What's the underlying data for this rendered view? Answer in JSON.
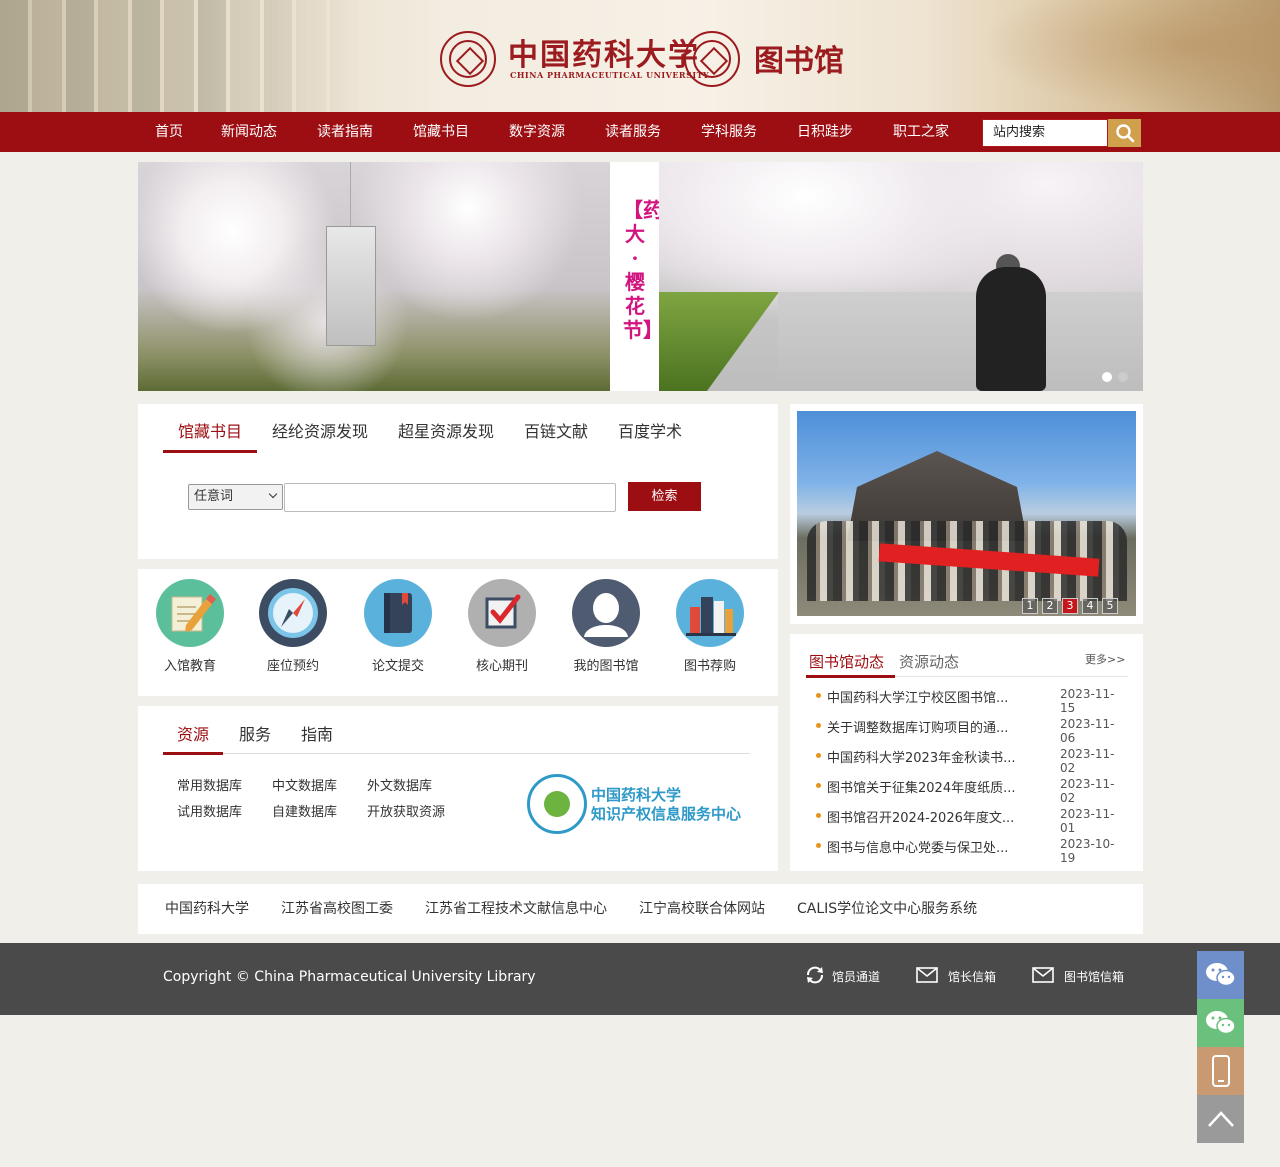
{
  "header": {
    "university_name": "中国药科大学",
    "university_en": "CHINA PHARMACEUTICAL UNIVERSITY",
    "library_name": "图书馆"
  },
  "nav": {
    "items": [
      "首页",
      "新闻动态",
      "读者指南",
      "馆藏书目",
      "数字资源",
      "读者服务",
      "学科服务",
      "日积跬步",
      "职工之家"
    ],
    "search_placeholder": "站内搜索"
  },
  "banner": {
    "vertical_title": "【药大·樱花节】",
    "slides": 2,
    "active_slide": 2
  },
  "catalog_search": {
    "tabs": [
      "馆藏书目",
      "经纶资源发现",
      "超星资源发现",
      "百链文献",
      "百度学术"
    ],
    "active_tab": "馆藏书目",
    "select_value": "任意词",
    "input_value": "",
    "button_label": "检索"
  },
  "quick_links": [
    {
      "label": "入馆教育",
      "icon": "pencil-note-icon",
      "color": "#5cbf9b"
    },
    {
      "label": "座位预约",
      "icon": "compass-icon",
      "color": "#3c4c63"
    },
    {
      "label": "论文提交",
      "icon": "book-icon",
      "color": "#59b1dc"
    },
    {
      "label": "核心期刊",
      "icon": "checkbox-icon",
      "color": "#b0b0b0"
    },
    {
      "label": "我的图书馆",
      "icon": "user-icon",
      "color": "#4f5b70"
    },
    {
      "label": "图书荐购",
      "icon": "books-icon",
      "color": "#59b1dc"
    }
  ],
  "resources": {
    "tabs": [
      "资源",
      "服务",
      "指南"
    ],
    "active_tab": "资源",
    "links_row1": [
      "常用数据库",
      "中文数据库",
      "外文数据库"
    ],
    "links_row2": [
      "试用数据库",
      "自建数据库",
      "开放获取资源"
    ],
    "ipc_title_1": "中国药科大学",
    "ipc_title_2": "知识产权信息服务中心"
  },
  "photo_carousel": {
    "pages": [
      "1",
      "2",
      "3",
      "4",
      "5"
    ],
    "active_page": "3"
  },
  "news": {
    "tabs": [
      "图书馆动态",
      "资源动态"
    ],
    "active_tab": "图书馆动态",
    "more_label": "更多>>",
    "items": [
      {
        "title": "中国药科大学江宁校区图书馆...",
        "date": "2023-11-15"
      },
      {
        "title": "关于调整数据库订购项目的通...",
        "date": "2023-11-06"
      },
      {
        "title": "中国药科大学2023年金秋读书...",
        "date": "2023-11-02"
      },
      {
        "title": "图书馆关于征集2024年度纸质...",
        "date": "2023-11-02"
      },
      {
        "title": "图书馆召开2024-2026年度文...",
        "date": "2023-11-01"
      },
      {
        "title": "图书与信息中心党委与保卫处...",
        "date": "2023-10-19"
      }
    ]
  },
  "friend_links": [
    "中国药科大学",
    "江苏省高校图工委",
    "江苏省工程技术文献信息中心",
    "江宁高校联合体网站",
    "CALIS学位论文中心服务系统"
  ],
  "footer": {
    "copyright": "Copyright © China Pharmaceutical University Library",
    "links": [
      {
        "label": "馆员通道",
        "icon": "refresh-icon"
      },
      {
        "label": "馆长信箱",
        "icon": "mail-icon"
      },
      {
        "label": "图书馆信箱",
        "icon": "mail-icon"
      }
    ]
  },
  "side_buttons": [
    {
      "icon": "wechat-icon",
      "color": "#6e8fc9"
    },
    {
      "icon": "wechat-icon",
      "color": "#6cc07d"
    },
    {
      "icon": "mobile-icon",
      "color": "#c99a72"
    },
    {
      "icon": "back-to-top-icon",
      "color": "#9a9a9a"
    }
  ]
}
